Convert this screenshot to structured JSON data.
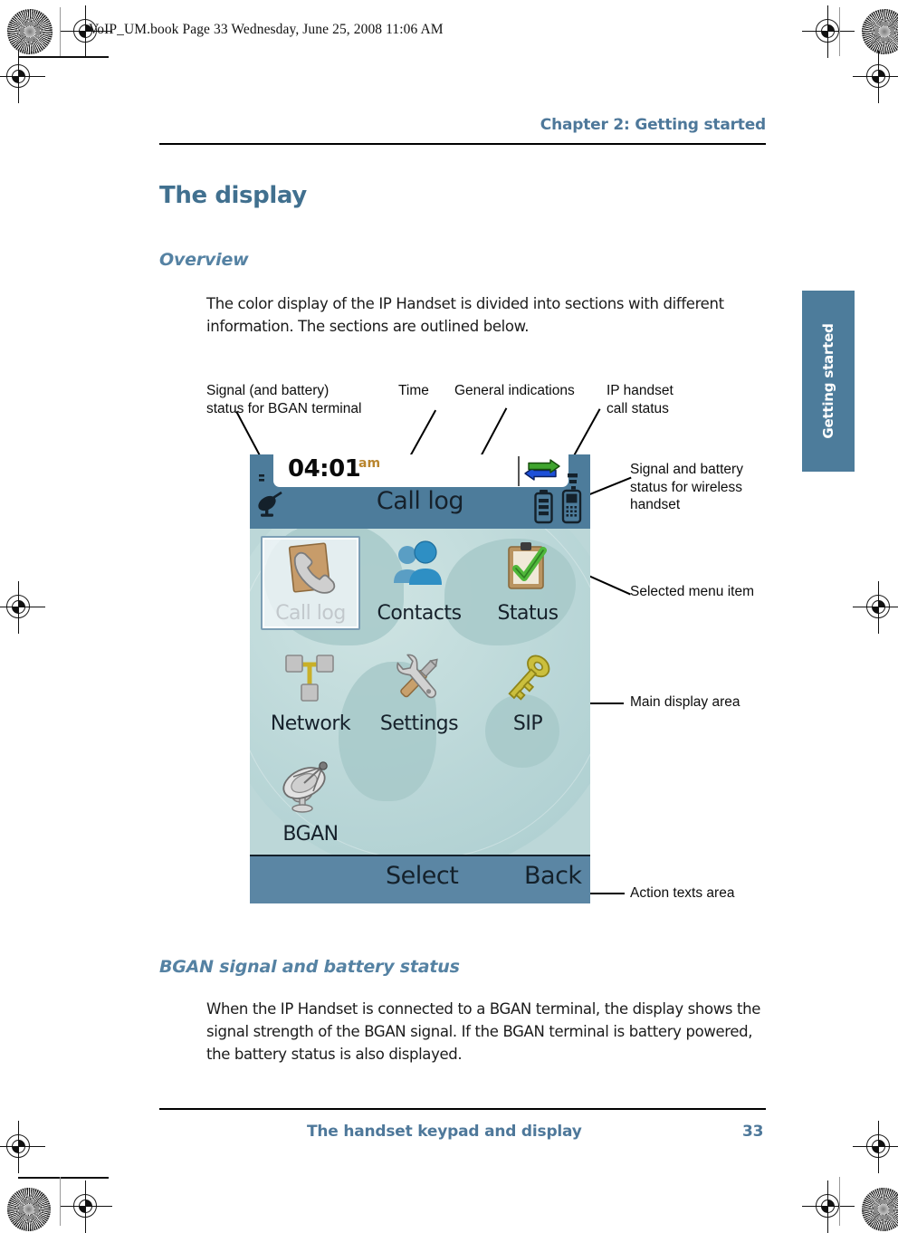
{
  "book_header": "VoIP_UM.book  Page 33  Wednesday, June 25, 2008  11:06 AM",
  "page": {
    "chapter_header": "Chapter 2:  Getting started",
    "title": "The display",
    "side_tab": "Getting started",
    "footer_title": "The handset keypad and display",
    "footer_page_number": "33"
  },
  "sections": [
    {
      "heading": "Overview",
      "paragraph": "The color display of the IP Handset is divided into sections with different information. The sections are outlined below."
    },
    {
      "heading": "BGAN signal and battery status",
      "paragraph": "When the IP Handset is connected to a BGAN terminal, the display shows the signal strength of the BGAN signal. If the BGAN terminal is battery powered, the battery status is also displayed."
    }
  ],
  "callouts": [
    {
      "id": "bgan-signal-battery",
      "text": "Signal (and battery)\nstatus for BGAN terminal"
    },
    {
      "id": "time",
      "text": "Time"
    },
    {
      "id": "general-indications",
      "text": "General indications"
    },
    {
      "id": "ip-handset-call-status",
      "text": "IP handset\ncall status"
    },
    {
      "id": "wireless-signal-battery",
      "text": "Signal and battery\nstatus for wireless\nhandset"
    },
    {
      "id": "selected-menu-item",
      "text": "Selected menu item"
    },
    {
      "id": "main-display-area",
      "text": "Main display area"
    },
    {
      "id": "action-texts-area",
      "text": "Action texts area"
    }
  ],
  "handset": {
    "status_bar": {
      "time": "04:01",
      "meridiem": "am",
      "bgan_signal_icon": "satellite-dish-icon",
      "call_status_icon": "call-arrows-icon",
      "wireless_battery_icon": "battery-icon",
      "wireless_handset_icon": "handset-signal-icon"
    },
    "screen_title": "Call log",
    "menu_items": [
      {
        "label": "Call log",
        "icon": "call-log-icon",
        "selected": true
      },
      {
        "label": "Contacts",
        "icon": "contacts-icon",
        "selected": false
      },
      {
        "label": "Status",
        "icon": "status-icon",
        "selected": false
      },
      {
        "label": "Network",
        "icon": "network-icon",
        "selected": false
      },
      {
        "label": "Settings",
        "icon": "settings-icon",
        "selected": false
      },
      {
        "label": "SIP",
        "icon": "sip-key-icon",
        "selected": false
      },
      {
        "label": "BGAN",
        "icon": "bgan-dish-icon",
        "selected": false
      }
    ],
    "actions": {
      "left": "Select",
      "right": "Back"
    }
  },
  "colors": {
    "accent_blue": "#4e789a",
    "title_blue": "#41708f",
    "screen_chrome": "#4d7c9b",
    "screen_main_bg": "#bcd7d8",
    "action_bar": "#5b86a4"
  }
}
